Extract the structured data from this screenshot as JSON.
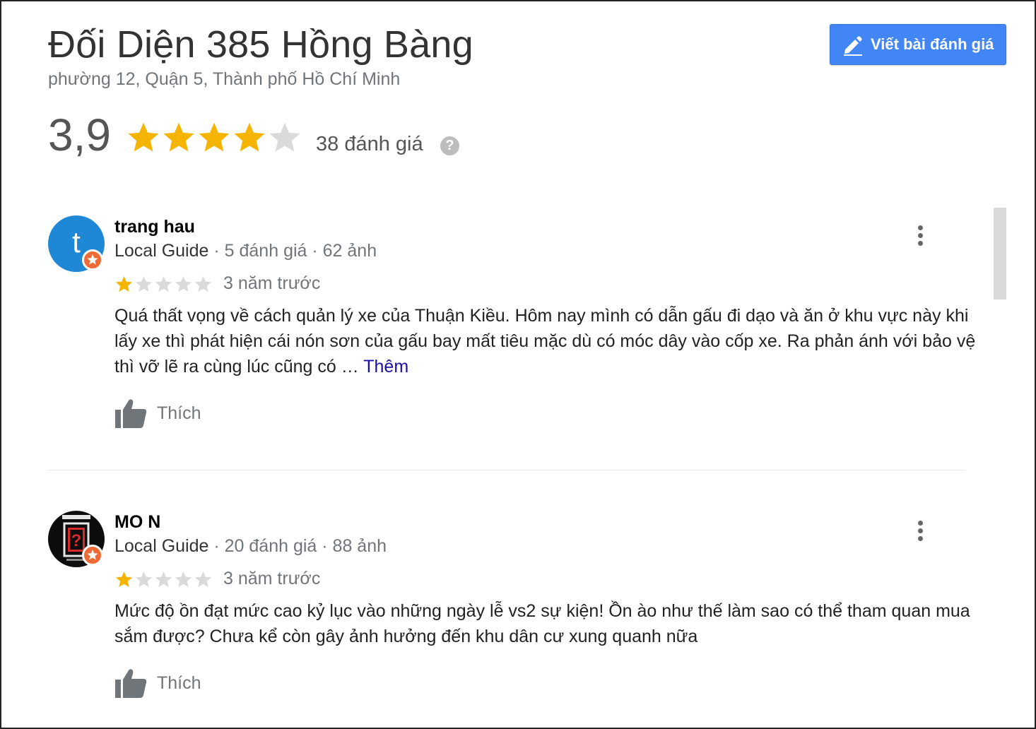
{
  "place": {
    "title": "Đối Diện 385 Hồng Bàng",
    "address": "phường 12, Quận 5, Thành phố Hồ Chí Minh"
  },
  "write_review_button": {
    "label": "Viết bài đánh giá",
    "icon": "pencil-icon"
  },
  "summary": {
    "rating": "3,9",
    "rating_value": 3.9,
    "max_stars": 5,
    "review_count": "38 đánh giá",
    "help_icon": "?"
  },
  "reviews": [
    {
      "reviewer": "trang hau",
      "avatar_letter": "t",
      "avatar_color": "#1e88d6",
      "guide_label": "Local Guide",
      "stats": " · 5 đánh giá · 62 ảnh",
      "stars": 1,
      "time": "3 năm trước",
      "text": "Quá thất vọng về cách quản lý xe của Thuận Kiều. Hôm nay mình có dẫn gấu đi dạo và ăn ở khu vực này khi lấy xe thì phát hiện cái nón sơn của gấu bay mất tiêu mặc dù có móc dây vào cốp xe. Ra phản ánh với bảo vệ thì vỡ lẽ ra cùng lúc cũng có … ",
      "more_label": "Thêm",
      "like_label": "Thích"
    },
    {
      "reviewer": "MO N",
      "avatar_letter": "?",
      "avatar_color": "#0d0d0d",
      "guide_label": "Local Guide",
      "stats": " · 20 đánh giá · 88 ảnh",
      "stars": 1,
      "time": "3 năm trước",
      "text": "Mức độ ồn đạt mức cao kỷ lục vào những ngày lễ vs2 sự kiện! Ồn ào như thế làm sao có thể tham quan mua sắm được? Chưa kể còn gây ảnh hưởng đến khu dân cư xung quanh nữa",
      "like_label": "Thích"
    }
  ],
  "colors": {
    "star_filled": "#f4b400",
    "star_empty": "#dadada",
    "accent_button": "#4285f4",
    "link": "#1a0dab",
    "guide_badge": "#f06a35"
  }
}
